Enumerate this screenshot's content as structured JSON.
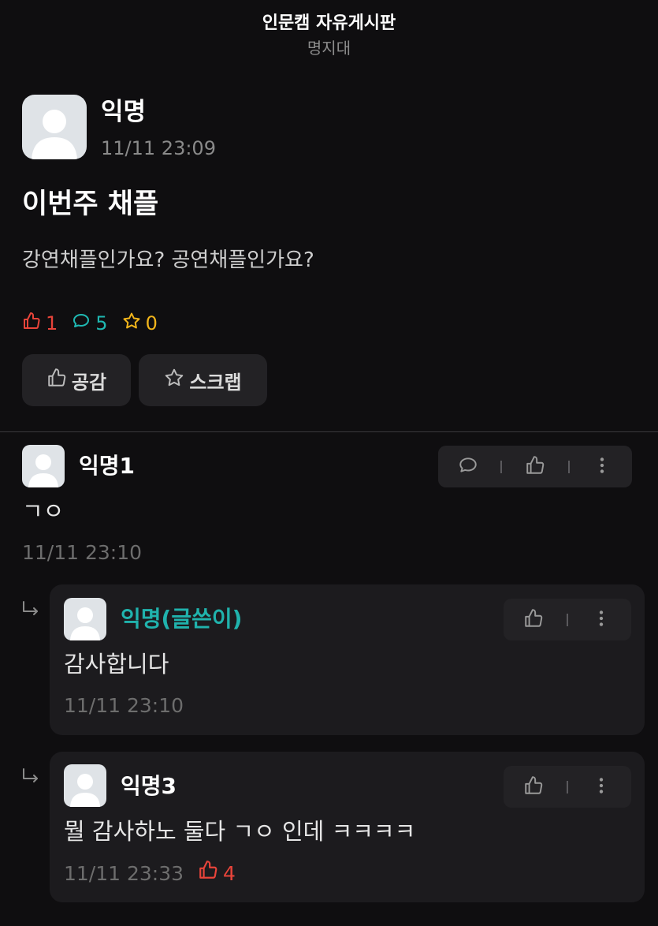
{
  "header": {
    "title": "인문캠 자유게시판",
    "subtitle": "명지대"
  },
  "post": {
    "author": "익명",
    "time": "11/11 23:09",
    "title": "이번주 채플",
    "body": "강연채플인가요? 공연채플인가요?",
    "stats": {
      "likes": "1",
      "comments": "5",
      "scraps": "0"
    },
    "buttons": {
      "like_label": "공감",
      "scrap_label": "스크랩"
    }
  },
  "comments": [
    {
      "author": "익명1",
      "body": "ㄱㅇ",
      "time": "11/11 23:10"
    }
  ],
  "replies": [
    {
      "author": "익명(글쓴이)",
      "body": "감사합니다",
      "time": "11/11 23:10"
    },
    {
      "author": "익명3",
      "body": "뭘 감사하노 둘다 ㄱㅇ 인데 ㅋㅋㅋㅋ",
      "time": "11/11 23:33",
      "likes": "4"
    }
  ],
  "colors": {
    "background": "#0f0e10",
    "like": "#e8443a",
    "comment": "#1fb8b2",
    "scrap": "#f2b51b",
    "op_author": "#20b3ad"
  },
  "icons": [
    "thumbs-up-icon",
    "speech-bubble-icon",
    "star-icon",
    "more-vertical-icon",
    "reply-arrow-icon"
  ]
}
